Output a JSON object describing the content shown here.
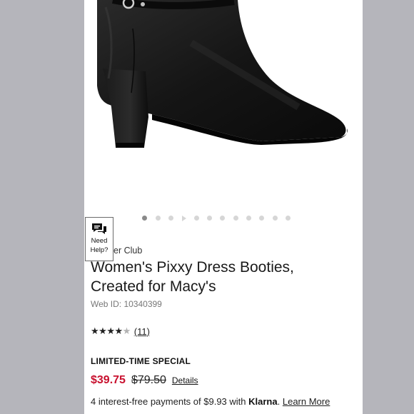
{
  "product": {
    "brand": "Alfani Charter Club",
    "brand_visible": "er Club",
    "title": "Women's Pixxy Dress Booties, Created for Macy's",
    "title_visible": "Women's Pixxy Dress Booties, Created for Macy's",
    "web_id": "Web ID: 10340399",
    "rating": 4,
    "rating_max": 5,
    "review_count": "(11)",
    "promo_label": "LIMITED-TIME SPECIAL",
    "sale_price": "$39.75",
    "original_price": "$79.50",
    "details_link": "Details",
    "klarna": {
      "text": "4 interest-free payments of $9.93 with",
      "brand": "Klarna",
      "link": "Learn More"
    }
  },
  "carousel": {
    "total": 12,
    "active_index": 0
  },
  "help_widget": {
    "label_line1": "Need",
    "label_line2": "Help?",
    "icon": "chat-bubbles-icon"
  },
  "colors": {
    "sale_red": "#c8102e",
    "page_bg": "#b5b5bb",
    "boot_leather": "#141414"
  },
  "image": {
    "icon": "black-ankle-bootie-image"
  }
}
